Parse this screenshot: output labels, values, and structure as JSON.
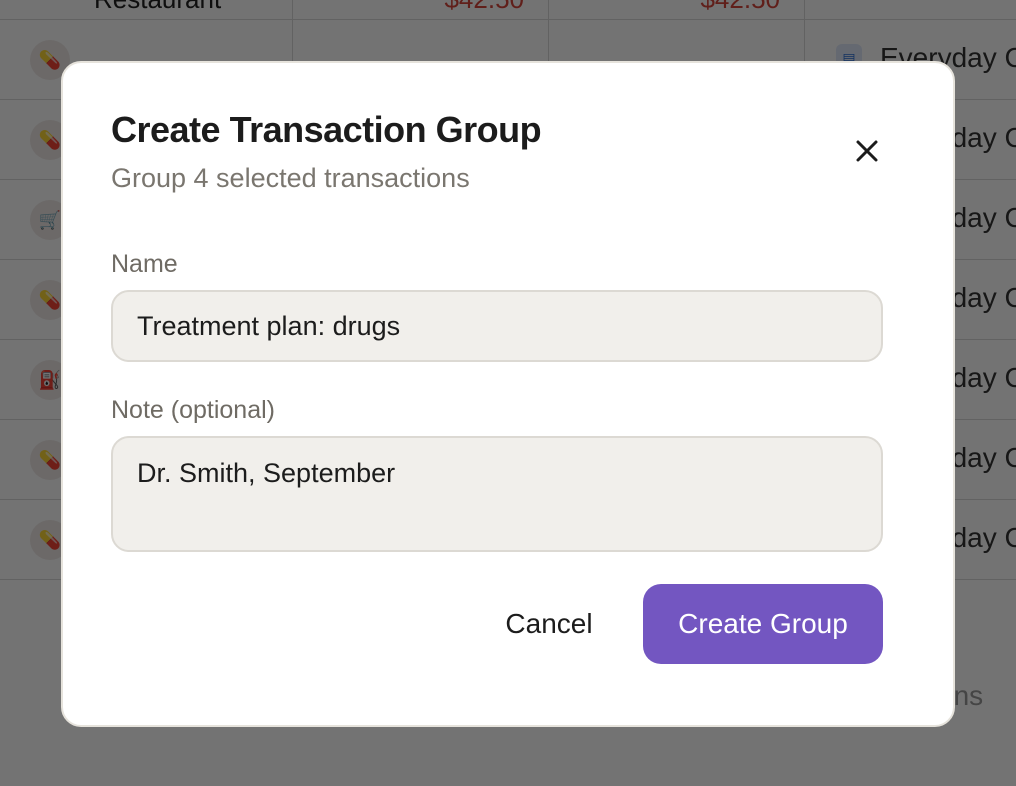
{
  "background": {
    "rows": [
      {
        "icon": "food-icon",
        "glyph": "◆",
        "merchant": "Restaurant",
        "amount": "$42.50",
        "amount2": "$42.50",
        "account": "Everyday C"
      },
      {
        "icon": "pill-icon",
        "glyph": "💊",
        "merchant": "",
        "amount": "",
        "amount2": "",
        "account": "Everyday C"
      },
      {
        "icon": "pill-icon",
        "glyph": "💊",
        "merchant": "",
        "amount": "",
        "amount2": "",
        "account": "Everyday C"
      },
      {
        "icon": "cart-icon",
        "glyph": "🛒",
        "merchant": "",
        "amount": "",
        "amount2": "",
        "account": "Everyday C"
      },
      {
        "icon": "pill-icon",
        "glyph": "💊",
        "merchant": "",
        "amount": "",
        "amount2": "",
        "account": "Everyday C"
      },
      {
        "icon": "fuel-icon",
        "glyph": "⛽",
        "merchant": "",
        "amount": "",
        "amount2": "",
        "account": "Everyday C"
      },
      {
        "icon": "pill-icon",
        "glyph": "💊",
        "merchant": "",
        "amount": "",
        "amount2": "",
        "account": "Everyday C"
      },
      {
        "icon": "pill-icon",
        "glyph": "💊",
        "merchant": "",
        "amount": "",
        "amount2": "",
        "account": "Everyday C"
      }
    ],
    "footer_text": "ransactions"
  },
  "modal": {
    "title": "Create Transaction Group",
    "subtitle": "Group 4 selected transactions",
    "close_icon": "close-icon",
    "name_label": "Name",
    "name_value": "Treatment plan: drugs",
    "note_label": "Note (optional)",
    "note_value": "Dr. Smith, September",
    "cancel_label": "Cancel",
    "create_label": "Create Group"
  },
  "colors": {
    "accent": "#7356c1",
    "amount_negative": "#d6453b",
    "overlay": "rgba(0,0,0,0.55)"
  }
}
